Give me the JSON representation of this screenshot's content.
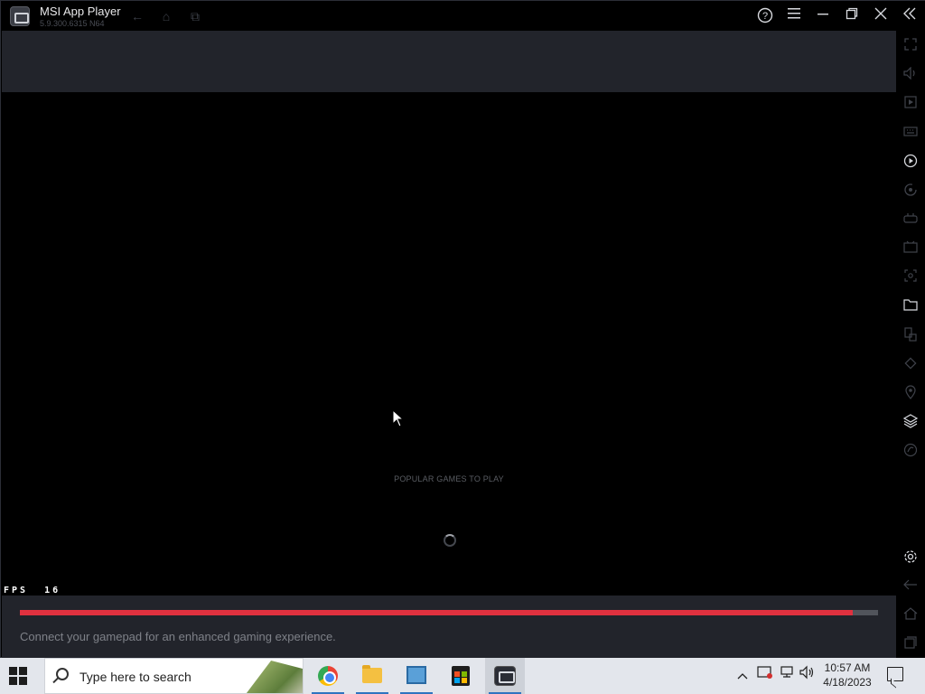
{
  "window": {
    "title": "MSI App Player",
    "version": "5.9.300.6315 N64"
  },
  "content": {
    "section_label": "POPULAR GAMES TO PLAY",
    "fps_label": "FPS",
    "fps_value": "16"
  },
  "bottom_panel": {
    "hint": "Connect your gamepad for an enhanced gaming experience.",
    "progress_percent": 97
  },
  "taskbar": {
    "search_placeholder": "Type here to search",
    "clock_time": "10:57 AM",
    "clock_date": "4/18/2023",
    "pinned_apps": [
      "Google Chrome",
      "File Explorer",
      "Control Panel",
      "Microsoft Store",
      "MSI App Player"
    ]
  },
  "sidebar_icons": [
    "fullscreen-icon",
    "volume-icon",
    "media-icon",
    "keyboard-icon",
    "macro-icon",
    "sync-icon",
    "gamepad-icon",
    "record-icon",
    "screenshot-icon",
    "folder-icon",
    "resize-icon",
    "rotate-icon",
    "location-icon",
    "layers-icon",
    "eco-icon",
    "settings-icon",
    "back-icon",
    "home-icon",
    "recent-apps-icon"
  ]
}
